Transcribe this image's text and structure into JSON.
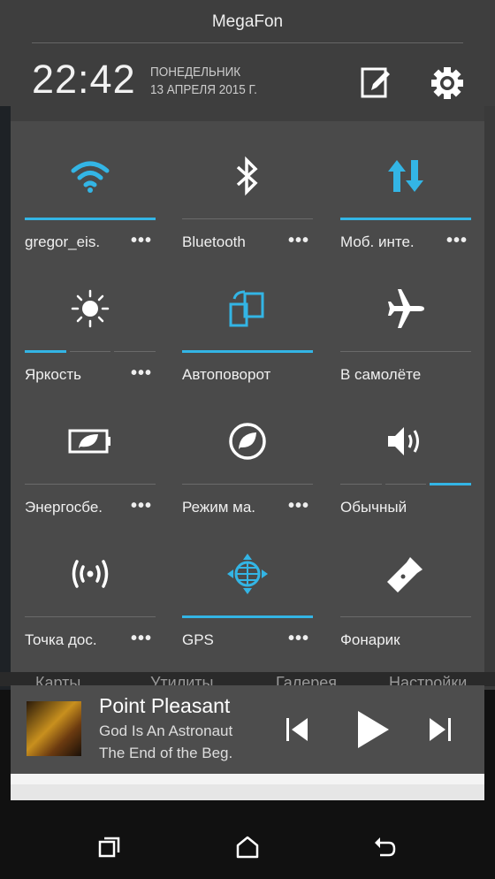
{
  "status": {
    "carrier": "MegaFon"
  },
  "header": {
    "time": "22:42",
    "weekday": "ПОНЕДЕЛЬНИК",
    "date": "13 АПРЕЛЯ 2015 Г."
  },
  "accent": "#33b5e5",
  "tiles": [
    {
      "label": "gregor_eis.",
      "icon": "wifi-icon",
      "active": true,
      "more": "•••"
    },
    {
      "label": "Bluetooth",
      "icon": "bluetooth-icon",
      "active": false,
      "more": "•••"
    },
    {
      "label": "Моб. инте.",
      "icon": "mobile-data-icon",
      "active": true,
      "more": "•••"
    },
    {
      "label": "Яркость",
      "icon": "brightness-icon",
      "level": "1 of 3",
      "more": "•••"
    },
    {
      "label": "Автоповорот",
      "icon": "auto-rotate-icon",
      "active": true
    },
    {
      "label": "В самолёте",
      "icon": "airplane-icon",
      "active": false
    },
    {
      "label": "Энергосбе.",
      "icon": "power-saver-icon",
      "active": false,
      "more": "•••"
    },
    {
      "label": "Режим ма.",
      "icon": "extreme-power-saver-icon",
      "active": false,
      "more": "•••"
    },
    {
      "label": "Обычный",
      "icon": "volume-icon",
      "level": "3 of 3"
    },
    {
      "label": "Точка дос.",
      "icon": "hotspot-icon",
      "active": false,
      "more": "•••"
    },
    {
      "label": "GPS",
      "icon": "gps-icon",
      "active": true,
      "more": "•••"
    },
    {
      "label": "Фонарик",
      "icon": "flashlight-icon",
      "active": false
    }
  ],
  "apps": [
    "Карты",
    "Утилиты",
    "Галерея",
    "Настройки"
  ],
  "music": {
    "title": "Point Pleasant",
    "artist": "God Is An Astronaut",
    "album": "The End of the Beg."
  }
}
